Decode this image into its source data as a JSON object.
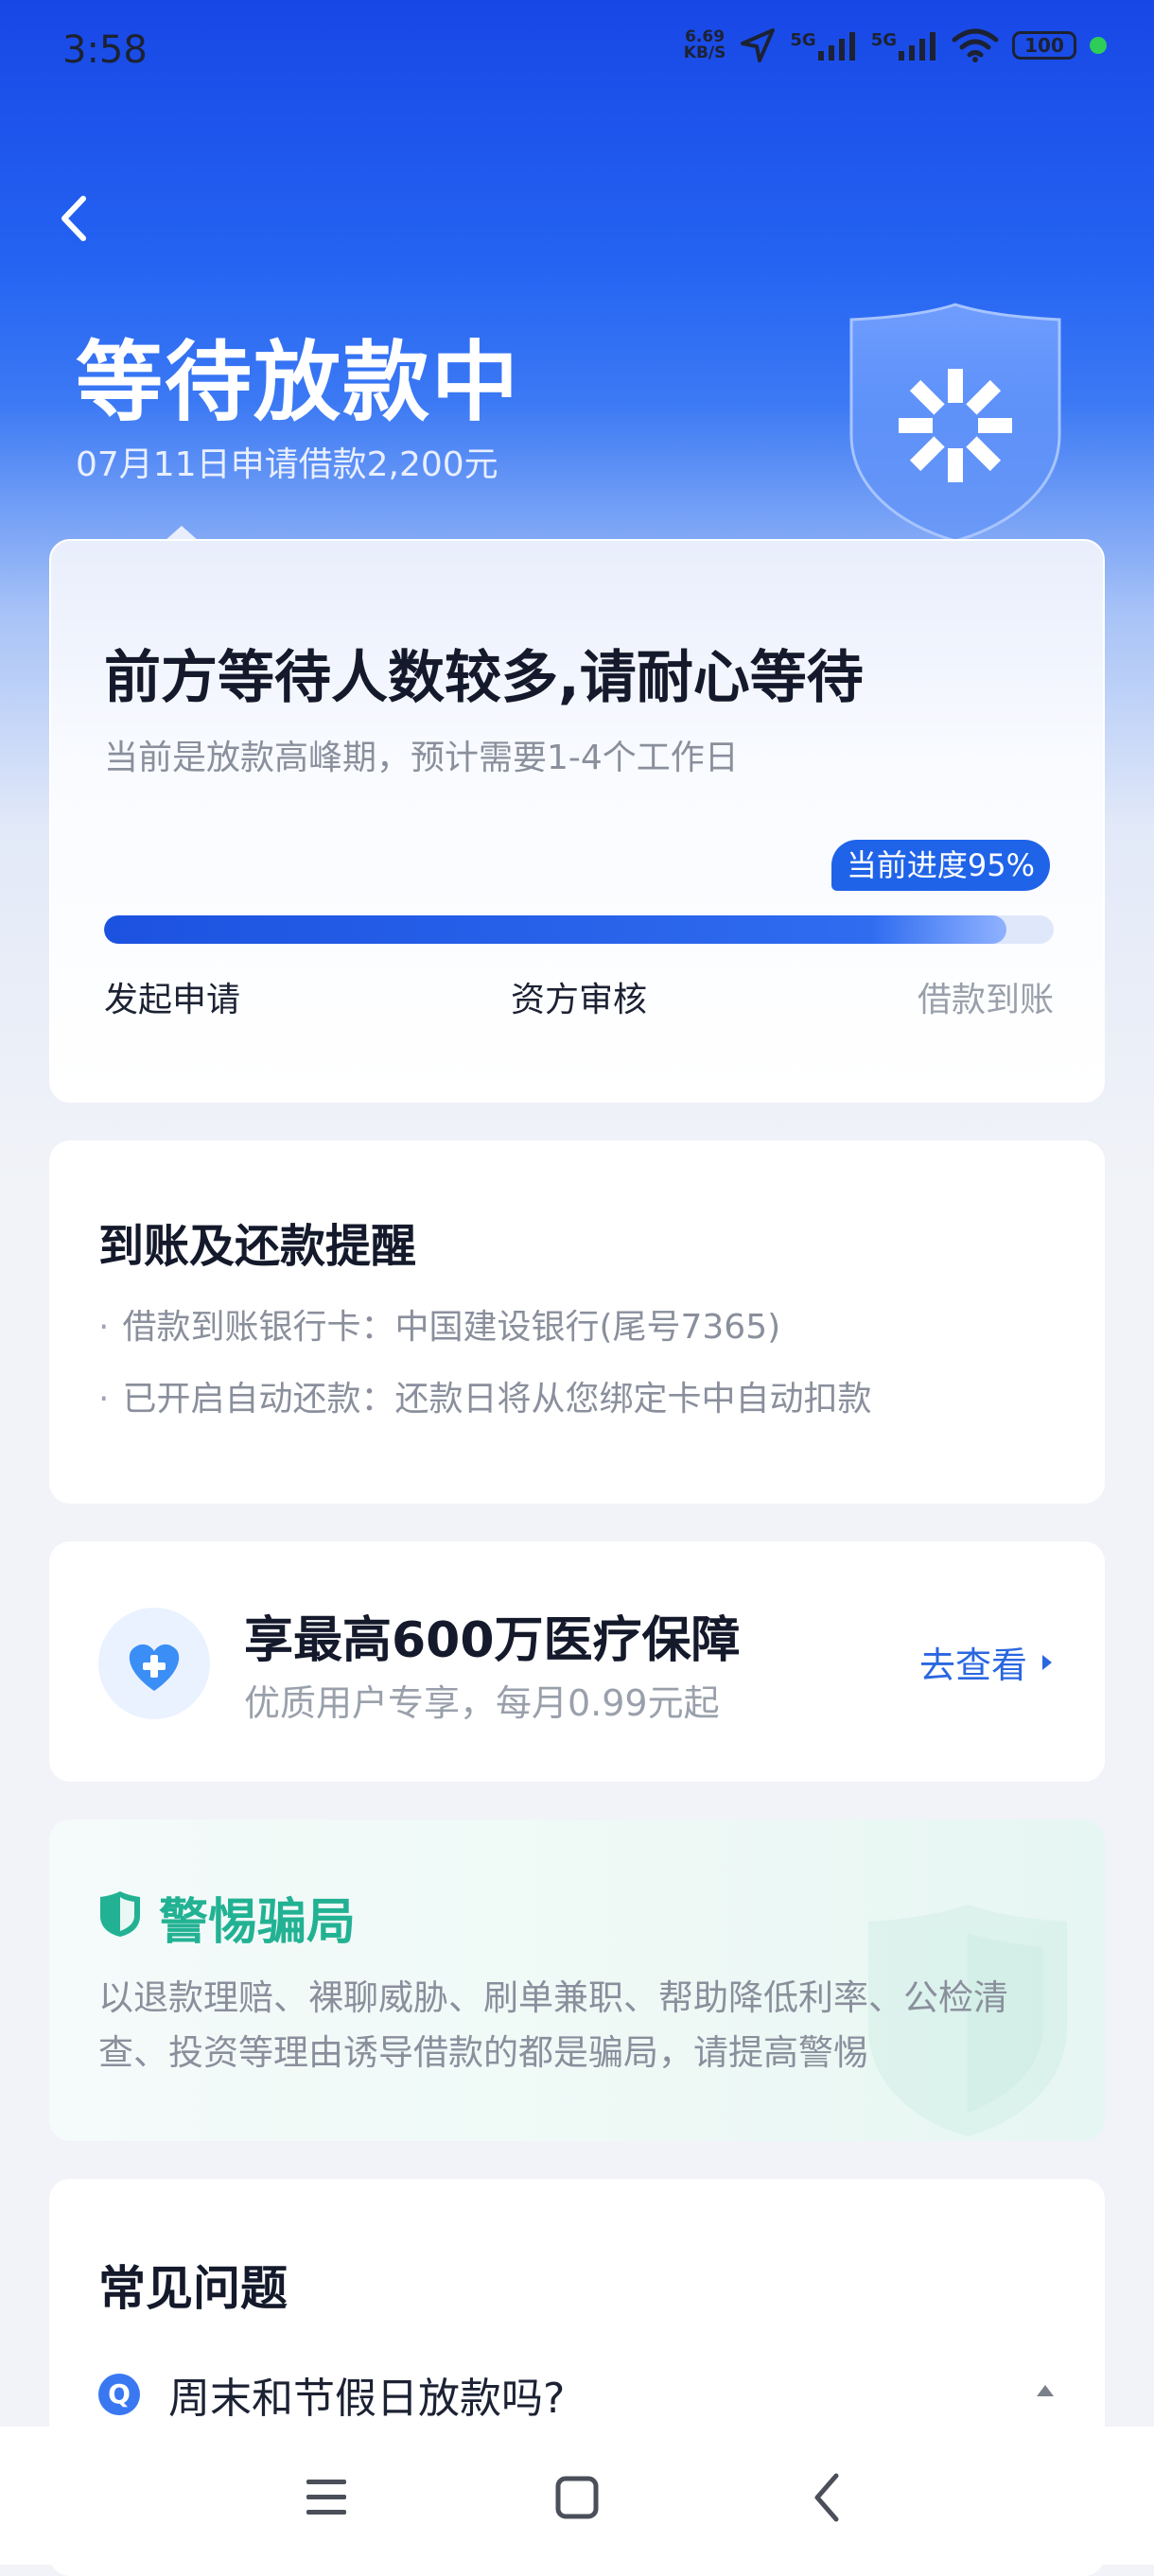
{
  "status_bar": {
    "time": "3:58",
    "net_speed_value": "6.69",
    "net_speed_unit": "KB/S",
    "signal1_label": "5G",
    "signal2_label": "5G",
    "battery": "100"
  },
  "header": {
    "title": "等待放款中",
    "subtitle": "07月11日申请借款2,200元"
  },
  "progress_card": {
    "heading": "前方等待人数较多,请耐心等待",
    "note": "当前是放款高峰期，预计需要1-4个工作日",
    "badge": "当前进度95%",
    "progress_percent": 95,
    "steps": [
      "发起申请",
      "资方审核",
      "借款到账"
    ]
  },
  "reminder": {
    "title": "到账及还款提醒",
    "lines": [
      "借款到账银行卡：中国建设银行(尾号7365)",
      "已开启自动还款：还款日将从您绑定卡中自动扣款"
    ]
  },
  "insurance": {
    "title": "享最高600万医疗保障",
    "subtitle": "优质用户专享，每月0.99元起",
    "link": "去查看"
  },
  "warning": {
    "title": "警惕骗局",
    "text": "以退款理赔、裸聊威胁、刷单兼职、帮助降低利率、公检清查、投资等理由诱导借款的都是骗局，请提高警惕"
  },
  "faq": {
    "title": "常见问题",
    "questions": [
      {
        "badge": "Q",
        "text": "周末和节假日放款吗?"
      }
    ]
  },
  "colors": {
    "primary_blue": "#1f63e8",
    "warning_green": "#22b293",
    "progress_track": "#dfe7fb"
  },
  "icons": {
    "back": "back-arrow-icon",
    "insurance": "heart-plus-icon",
    "warning": "shield-check-icon",
    "nav_menu": "menu-icon",
    "nav_home": "home-square-icon",
    "nav_back": "nav-back-icon"
  }
}
